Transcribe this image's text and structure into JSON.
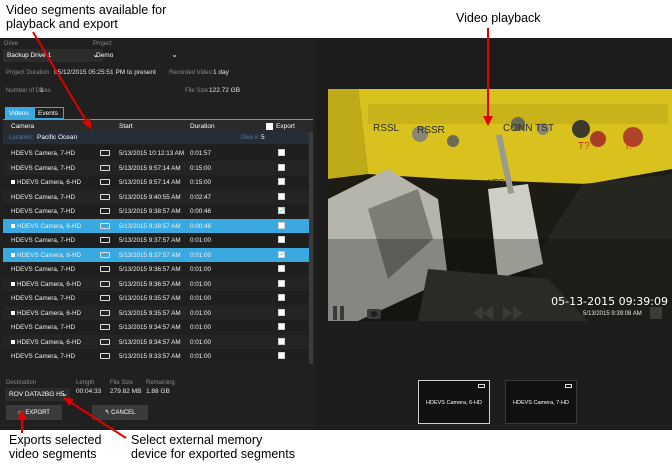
{
  "annotations": {
    "top_left": "Video segments available for\nplayback and export",
    "top_right": "Video playback",
    "bottom_left": "Exports selected\nvideo segments",
    "bottom_mid": "Select external memory\ndevice for exported segments"
  },
  "drive": {
    "label": "Drive",
    "value": "Backup Drive 1"
  },
  "project": {
    "label": "Project",
    "value": "Demo"
  },
  "info": {
    "duration_label": "Project Duration",
    "duration_value": "05/12/2015 05:25:51 PM to present",
    "recorded_label": "Recorded Video",
    "recorded_value": "1 day",
    "dives_label": "Number of Dives",
    "dives_value": "1",
    "size_label": "File Size",
    "size_value": "122.72 GB"
  },
  "tabs": [
    "Videos",
    "Events"
  ],
  "table": {
    "headers": {
      "camera": "Camera",
      "start": "Start",
      "duration": "Duration",
      "export": "Export"
    },
    "group": {
      "location_label": "Location:",
      "location_value": "Pacific Ocean",
      "dive_label": "Dive #:",
      "dive_value": "5"
    },
    "rows": [
      {
        "camera": "HDEVS Camera, 7-HD",
        "start": "5/13/2015 10:12:13 AM",
        "duration": "0:01:57",
        "checked": false,
        "selected": false,
        "marker": false
      },
      {
        "camera": "HDEVS Camera, 7-HD",
        "start": "5/13/2015 9:57:14 AM",
        "duration": "0:15:00",
        "checked": false,
        "selected": false,
        "marker": false
      },
      {
        "camera": "HDEVS Camera, 6-HD",
        "start": "5/13/2015 9:57:14 AM",
        "duration": "0:15:00",
        "checked": false,
        "selected": false,
        "marker": true
      },
      {
        "camera": "HDEVS Camera, 7-HD",
        "start": "5/13/2015 9:40:55 AM",
        "duration": "0:02:47",
        "checked": false,
        "selected": false,
        "marker": false
      },
      {
        "camera": "HDEVS Camera, 7-HD",
        "start": "5/13/2015 9:38:57 AM",
        "duration": "0:00:46",
        "checked": true,
        "selected": false,
        "marker": false
      },
      {
        "camera": "HDEVS Camera, 6-HD",
        "start": "5/13/2015 9:38:57 AM",
        "duration": "0:00:46",
        "checked": false,
        "selected": true,
        "marker": true
      },
      {
        "camera": "HDEVS Camera, 7-HD",
        "start": "5/13/2015 9:37:57 AM",
        "duration": "0:01:00",
        "checked": false,
        "selected": false,
        "marker": false
      },
      {
        "camera": "HDEVS Camera, 6-HD",
        "start": "5/13/2015 9:37:57 AM",
        "duration": "0:01:00",
        "checked": true,
        "selected": true,
        "marker": true
      },
      {
        "camera": "HDEVS Camera, 7-HD",
        "start": "5/13/2015 9:36:57 AM",
        "duration": "0:01:00",
        "checked": false,
        "selected": false,
        "marker": false
      },
      {
        "camera": "HDEVS Camera, 6-HD",
        "start": "5/13/2015 9:36:57 AM",
        "duration": "0:01:00",
        "checked": false,
        "selected": false,
        "marker": true
      },
      {
        "camera": "HDEVS Camera, 7-HD",
        "start": "5/13/2015 9:35:57 AM",
        "duration": "0:01:00",
        "checked": false,
        "selected": false,
        "marker": false
      },
      {
        "camera": "HDEVS Camera, 6-HD",
        "start": "5/13/2015 9:35:57 AM",
        "duration": "0:01:00",
        "checked": false,
        "selected": false,
        "marker": true
      },
      {
        "camera": "HDEVS Camera, 7-HD",
        "start": "5/13/2015 9:34:57 AM",
        "duration": "0:01:00",
        "checked": false,
        "selected": false,
        "marker": false
      },
      {
        "camera": "HDEVS Camera, 6-HD",
        "start": "5/13/2015 9:34:57 AM",
        "duration": "0:01:00",
        "checked": false,
        "selected": false,
        "marker": true
      },
      {
        "camera": "HDEVS Camera, 7-HD",
        "start": "5/13/2015 9:33:57 AM",
        "duration": "0:01:00",
        "checked": false,
        "selected": false,
        "marker": false
      }
    ]
  },
  "footer": {
    "dest_label": "Destination",
    "dest_value": "ROV DATA2BG H5",
    "length_label": "Length",
    "length_value": "00:04:33",
    "filesize_label": "File Size",
    "filesize_value": "279.82 MB",
    "remaining_label": "Remaining",
    "remaining_value": "1.88 GB",
    "export_label": "EXPORT",
    "cancel_label": "CANCEL"
  },
  "video": {
    "timestamp": "05-13-2015 09:39:09",
    "playback_time": "5/13/2015 9:39:08 AM",
    "plate_texts": [
      "RSSL",
      "RSSR",
      "CONN TST",
      "UPST",
      "T?",
      "T:"
    ],
    "thumbnails": [
      {
        "label": "HDEVS Camera, 6-HD"
      },
      {
        "label": "HDEVS Camera, 7-HD"
      }
    ]
  },
  "icons": [
    "pause-icon",
    "camera-icon",
    "rewind-icon",
    "fast-forward-icon",
    "fullscreen-icon",
    "export-icon",
    "back-arrow-icon",
    "chevron-down-icon"
  ],
  "colors": {
    "accent": "#3aa9e0",
    "panel": "#202020",
    "annotation_arrow": "#e00000",
    "plate_yellow": "#d9c21e"
  }
}
